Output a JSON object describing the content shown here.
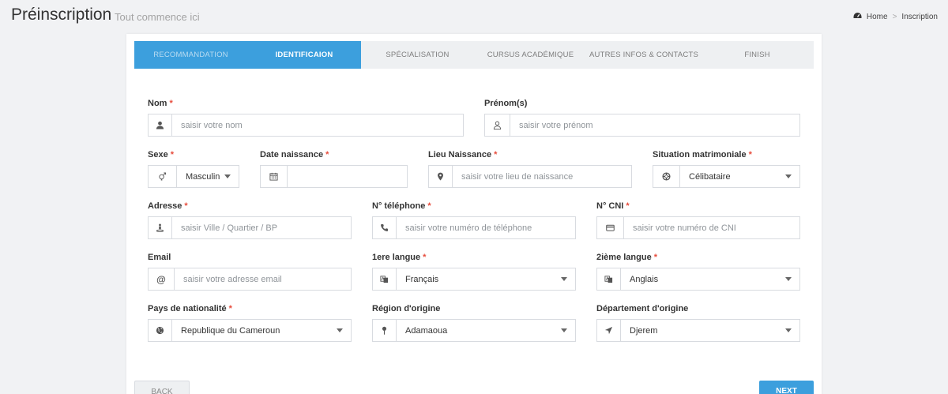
{
  "header": {
    "title": "Préinscription",
    "subtitle": "Tout commence ici"
  },
  "breadcrumb": {
    "home": "Home",
    "separator": ">",
    "current": "Inscription"
  },
  "steps": [
    {
      "label": "RECOMMANDATION",
      "state": "done"
    },
    {
      "label": "IDENTIFICAION",
      "state": "active"
    },
    {
      "label": "SPÉCIALISATION",
      "state": "todo"
    },
    {
      "label": "CURSUS ACADÉMIQUE",
      "state": "todo"
    },
    {
      "label": "AUTRES INFOS & CONTACTS",
      "state": "todo"
    },
    {
      "label": "FINISH",
      "state": "todo"
    }
  ],
  "form": {
    "nom": {
      "label": "Nom",
      "required": "*",
      "placeholder": "saisir votre nom",
      "icon": "user-icon"
    },
    "prenom": {
      "label": "Prénom(s)",
      "placeholder": "saisir votre prénom",
      "icon": "user-outline-icon"
    },
    "sexe": {
      "label": "Sexe",
      "required": "*",
      "value": "Masculin",
      "icon": "gender-icon"
    },
    "date_naissance": {
      "label": "Date naissance",
      "required": "*",
      "value": "",
      "icon": "calendar-icon"
    },
    "lieu_naissance": {
      "label": "Lieu Naissance",
      "required": "*",
      "placeholder": "saisir votre lieu de naissance",
      "icon": "map-marker-icon"
    },
    "situation": {
      "label": "Situation matrimoniale",
      "required": "*",
      "value": "Célibataire",
      "icon": "life-ring-icon"
    },
    "adresse": {
      "label": "Adresse",
      "required": "*",
      "placeholder": "saisir Ville / Quartier / BP",
      "icon": "street-view-icon"
    },
    "telephone": {
      "label": "N° téléphone",
      "required": "*",
      "placeholder": "saisir votre numéro de téléphone",
      "icon": "phone-icon"
    },
    "cni": {
      "label": "N° CNI",
      "required": "*",
      "placeholder": "saisir votre numéro de CNI",
      "icon": "id-card-icon"
    },
    "email": {
      "label": "Email",
      "placeholder": "saisir votre adresse email",
      "icon": "at-icon"
    },
    "langue1": {
      "label": "1ere langue",
      "required": "*",
      "value": "Français",
      "icon": "language-icon"
    },
    "langue2": {
      "label": "2ième langue",
      "required": "*",
      "value": "Anglais",
      "icon": "language-icon"
    },
    "pays": {
      "label": "Pays de nationalité",
      "required": "*",
      "value": "Republique du Cameroun",
      "icon": "globe-icon"
    },
    "region": {
      "label": "Région d'origine",
      "value": "Adamaoua",
      "icon": "map-pin-icon"
    },
    "departement": {
      "label": "Département d'origine",
      "value": "Djerem",
      "icon": "location-arrow-icon"
    }
  },
  "buttons": {
    "back": "BACK",
    "next": "NEXT"
  },
  "colors": {
    "accent": "#3c9fdd",
    "required": "#e74c3c"
  }
}
